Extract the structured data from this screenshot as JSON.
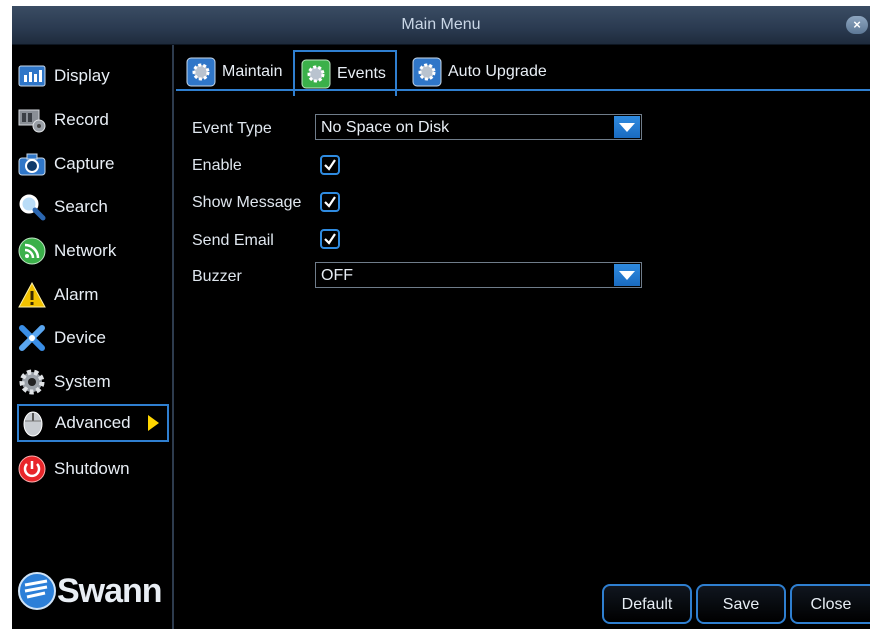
{
  "window": {
    "title": "Main Menu",
    "close_label": "×"
  },
  "sidebar": {
    "items": [
      {
        "label": "Display",
        "icon": "display-icon"
      },
      {
        "label": "Record",
        "icon": "record-icon"
      },
      {
        "label": "Capture",
        "icon": "camera-icon"
      },
      {
        "label": "Search",
        "icon": "search-icon"
      },
      {
        "label": "Network",
        "icon": "network-icon"
      },
      {
        "label": "Alarm",
        "icon": "alarm-icon"
      },
      {
        "label": "Device",
        "icon": "device-icon"
      },
      {
        "label": "System",
        "icon": "system-icon"
      },
      {
        "label": "Advanced",
        "icon": "advanced-icon",
        "active": true
      },
      {
        "label": "Shutdown",
        "icon": "shutdown-icon"
      }
    ],
    "logo_text": "Swann"
  },
  "tabs": [
    {
      "label": "Maintain"
    },
    {
      "label": "Events",
      "active": true
    },
    {
      "label": "Auto Upgrade"
    }
  ],
  "form": {
    "event_type": {
      "label": "Event Type",
      "value": "No Space on Disk"
    },
    "enable": {
      "label": "Enable",
      "checked": true
    },
    "show_message": {
      "label": "Show Message",
      "checked": true
    },
    "send_email": {
      "label": "Send Email",
      "checked": true
    },
    "buzzer": {
      "label": "Buzzer",
      "value": "OFF"
    }
  },
  "buttons": {
    "default": "Default",
    "save": "Save",
    "close": "Close"
  },
  "colors": {
    "accent": "#2f7fd0",
    "background": "#000000",
    "arrow": "#ffd600"
  }
}
